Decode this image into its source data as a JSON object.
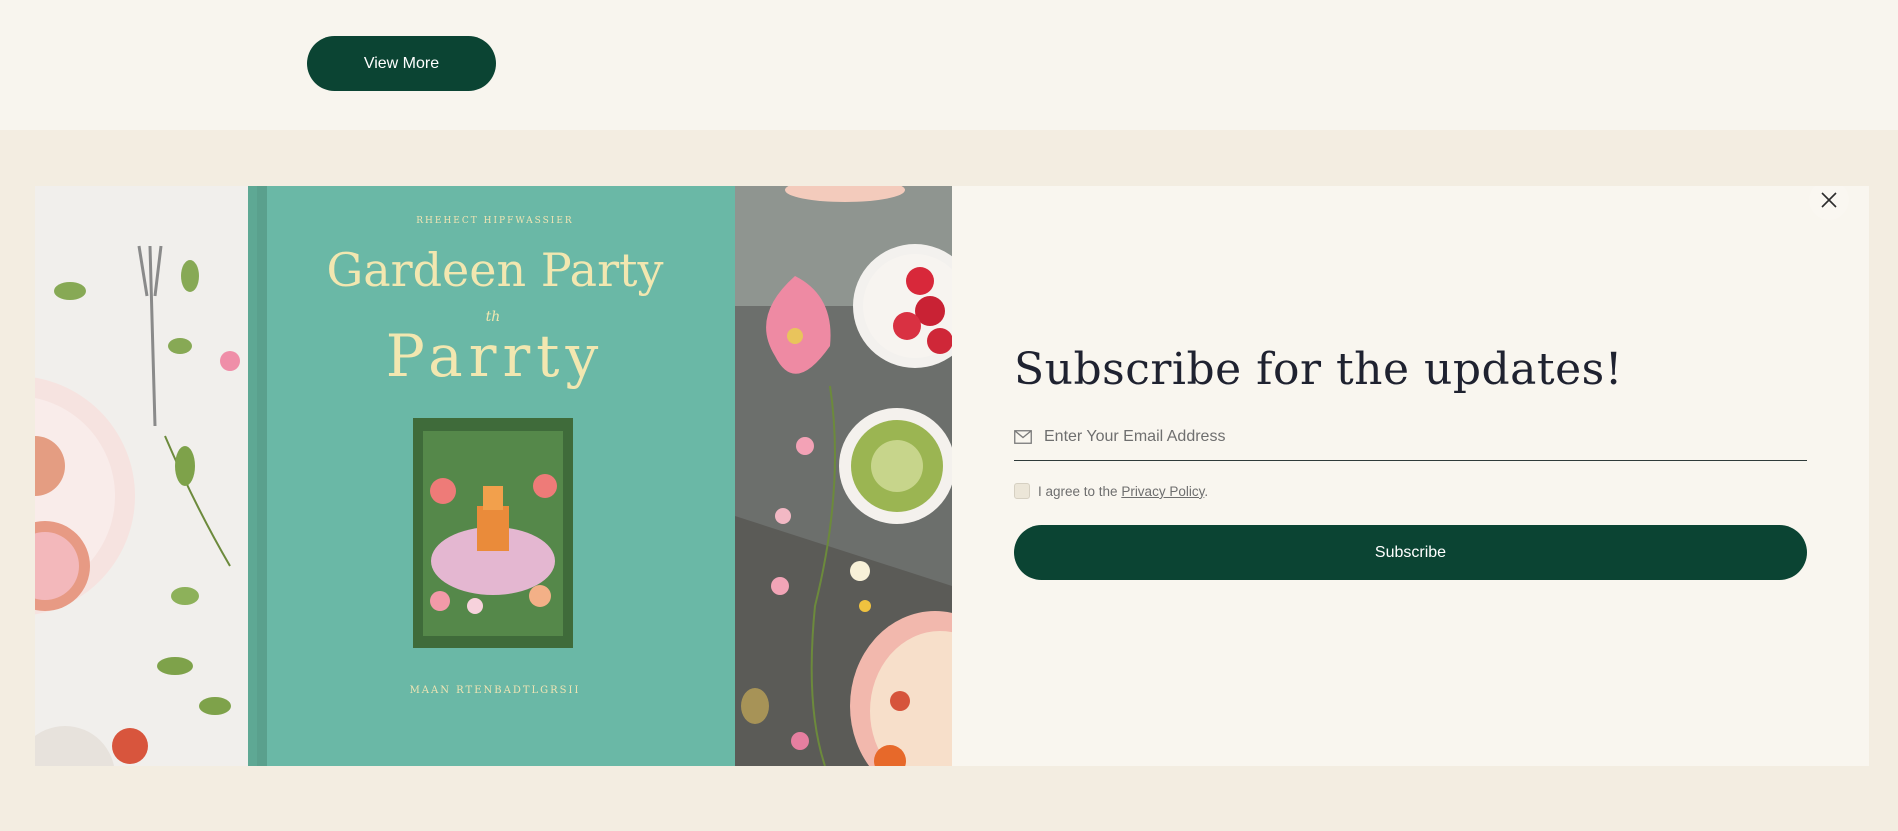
{
  "top": {
    "view_more_label": "View More"
  },
  "modal": {
    "title": "Subscribe for the updates!",
    "email_placeholder": "Enter Your Email Address",
    "agree_text": "I agree to the ",
    "privacy_link": "Privacy Policy",
    "agree_suffix": ".",
    "subscribe_label": "Subscribe",
    "icons": {
      "close": "close-icon",
      "email": "envelope-icon"
    }
  },
  "artwork": {
    "book_title_line1": "Gardeen Party",
    "book_title_small": "th",
    "book_title_line2": "Parrty",
    "book_top_text": "RHEHECT HIPFWASSIER",
    "book_author": "MAAN RTENBADTLGRSII"
  },
  "colors": {
    "accent": "#0b4433",
    "page_bg": "#f3ede1",
    "top_band": "#f8f5ee",
    "modal_bg": "#f9f6ef",
    "book_cover": "#6ab8a6"
  }
}
